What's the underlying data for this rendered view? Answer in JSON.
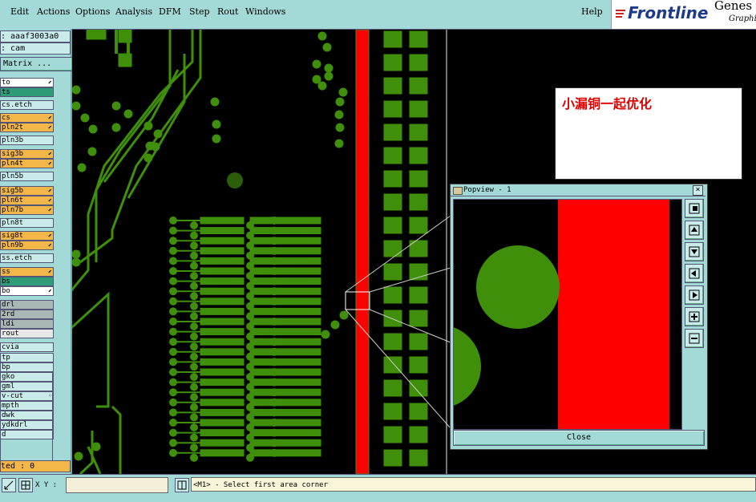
{
  "menubar": {
    "items": [
      "Edit",
      "Actions",
      "Options",
      "Analysis",
      "DFM",
      "Step",
      "Rout",
      "Windows"
    ],
    "help": "Help"
  },
  "logo": {
    "brand": "Frontline",
    "product": "Genes",
    "sub": "Graphi"
  },
  "left_panel": {
    "job": ": aaaf3003a0",
    "step": ": cam",
    "matrix": "Matrix ...",
    "selected": "ted : 0",
    "layers": [
      {
        "name": "to",
        "color": "white",
        "mark": "⬋"
      },
      {
        "name": "ts",
        "color": "green",
        "mark": ""
      },
      {
        "name": "cs.etch",
        "color": "cyan",
        "mark": ""
      },
      {
        "name": "cs",
        "color": "orange",
        "mark": "⬋"
      },
      {
        "name": "pln2t",
        "color": "orange",
        "mark": "⬋"
      },
      {
        "name": "pln3b",
        "color": "cyan",
        "mark": ""
      },
      {
        "name": "sig3b",
        "color": "orange",
        "mark": "⬋"
      },
      {
        "name": "pln4t",
        "color": "orange",
        "mark": "⬋"
      },
      {
        "name": "pln5b",
        "color": "cyan",
        "mark": ""
      },
      {
        "name": "sig5b",
        "color": "orange",
        "mark": "⬋"
      },
      {
        "name": "pln6t",
        "color": "orange",
        "mark": "⬋"
      },
      {
        "name": "pln7b",
        "color": "orange",
        "mark": "⬋"
      },
      {
        "name": "pln8t",
        "color": "cyan",
        "mark": ""
      },
      {
        "name": "sig8t",
        "color": "orange",
        "mark": "⬋"
      },
      {
        "name": "pln9b",
        "color": "orange",
        "mark": "⬋"
      },
      {
        "name": "ss.etch",
        "color": "cyan",
        "mark": ""
      },
      {
        "name": "ss",
        "color": "orange",
        "mark": "⬋"
      },
      {
        "name": "bs",
        "color": "green",
        "mark": ""
      },
      {
        "name": "bo",
        "color": "white",
        "mark": "⬋"
      },
      {
        "name": "drl",
        "color": "gray",
        "mark": ""
      },
      {
        "name": "2rd",
        "color": "gray",
        "mark": ""
      },
      {
        "name": "ldi",
        "color": "gray",
        "mark": ""
      },
      {
        "name": "rout",
        "color": "light",
        "mark": ""
      },
      {
        "name": "cvia",
        "color": "cyan",
        "mark": ""
      },
      {
        "name": "tp",
        "color": "cyan",
        "mark": ""
      },
      {
        "name": "bp",
        "color": "cyan",
        "mark": ""
      },
      {
        "name": "gko",
        "color": "cyan",
        "mark": ""
      },
      {
        "name": "gml",
        "color": "cyan",
        "mark": ""
      },
      {
        "name": "v-cut",
        "color": "cyan",
        "mark": "◦"
      },
      {
        "name": "mpth",
        "color": "cyan",
        "mark": ""
      },
      {
        "name": "dwk",
        "color": "cyan",
        "mark": ""
      },
      {
        "name": "ydkdrl",
        "color": "cyan",
        "mark": ""
      },
      {
        "name": "d",
        "color": "cyan",
        "mark": ""
      }
    ]
  },
  "annotation": {
    "text": "小漏铜一起优化"
  },
  "popview": {
    "title": "Popview - 1",
    "close_label": "Close",
    "tools": [
      "zoom-fit-icon",
      "pan-up-icon",
      "pan-down-icon",
      "pan-left-icon",
      "pan-right-icon",
      "zoom-in-icon",
      "zoom-out-icon"
    ]
  },
  "statusbar": {
    "xy_label": "X Y :",
    "coordinate_value": "",
    "message": "<M1> - Select first area corner"
  },
  "colors": {
    "copper": "#3f8f0a",
    "highlight": "#ff0000",
    "panel": "#a3d9d6"
  }
}
